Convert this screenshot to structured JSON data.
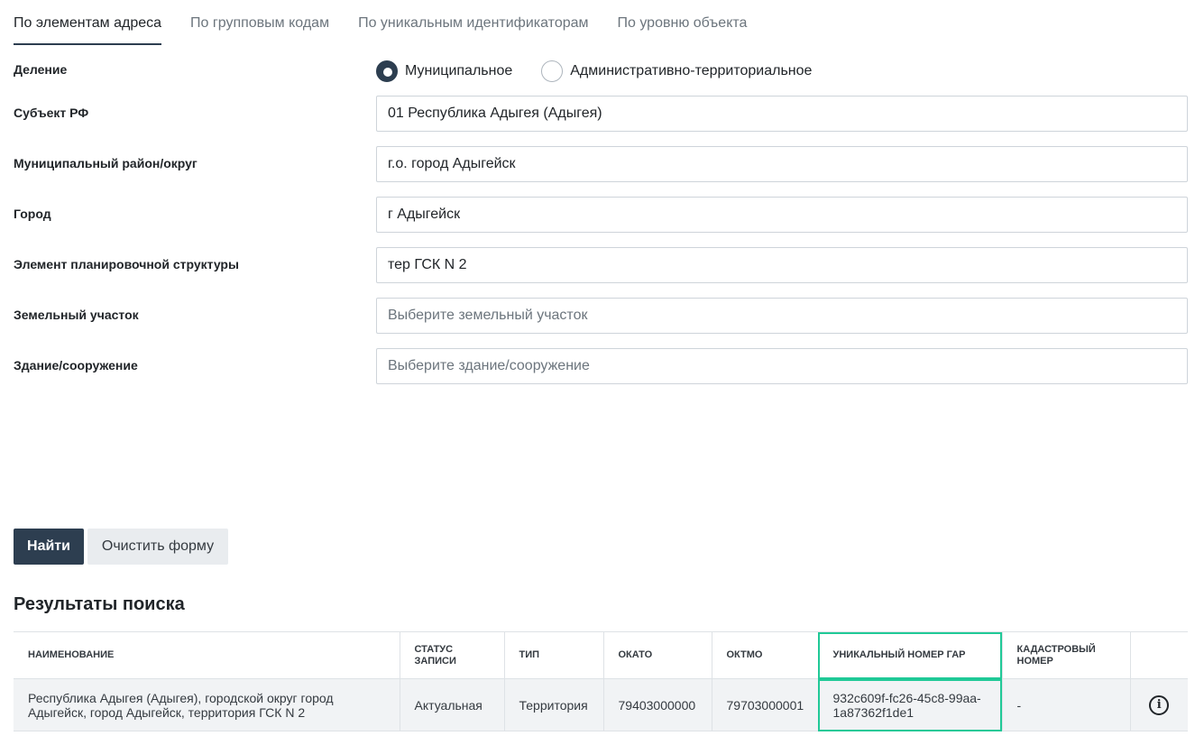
{
  "tabs": [
    {
      "label": "По элементам адреса",
      "active": true
    },
    {
      "label": "По групповым кодам",
      "active": false
    },
    {
      "label": "По уникальным идентификаторам",
      "active": false
    },
    {
      "label": "По уровню объекта",
      "active": false
    }
  ],
  "division": {
    "label": "Деление",
    "options": [
      {
        "label": "Муниципальное",
        "checked": true
      },
      {
        "label": "Административно-территориальное",
        "checked": false
      }
    ]
  },
  "fields": [
    {
      "label": "Субъект РФ",
      "value": "01 Республика Адыгея (Адыгея)",
      "placeholder": ""
    },
    {
      "label": "Муниципальный район/округ",
      "value": "г.о. город Адыгейск",
      "placeholder": ""
    },
    {
      "label": "Город",
      "value": "г Адыгейск",
      "placeholder": ""
    },
    {
      "label": "Элемент планировочной структуры",
      "value": "тер ГСК N 2",
      "placeholder": ""
    },
    {
      "label": "Земельный участок",
      "value": "",
      "placeholder": "Выберите земельный участок"
    },
    {
      "label": "Здание/сооружение",
      "value": "",
      "placeholder": "Выберите здание/сооружение"
    }
  ],
  "buttons": {
    "find": "Найти",
    "clear": "Очистить форму"
  },
  "results": {
    "title": "Результаты поиска",
    "columns": [
      "Наименование",
      "Статус записи",
      "Тип",
      "ОКАТО",
      "ОКТМО",
      "Уникальный номер ГАР",
      "Кадастровый номер",
      ""
    ],
    "rows": [
      {
        "name": "Республика Адыгея (Адыгея), городской округ город Адыгейск, город Адыгейск, территория ГСК N 2",
        "status": "Актуальная",
        "type": "Территория",
        "okato": "79403000000",
        "oktmo": "79703000001",
        "gar": "932c609f-fc26-45c8-99aa-1a87362f1de1",
        "cadastral": "-",
        "info_icon": "info-icon"
      }
    ]
  }
}
